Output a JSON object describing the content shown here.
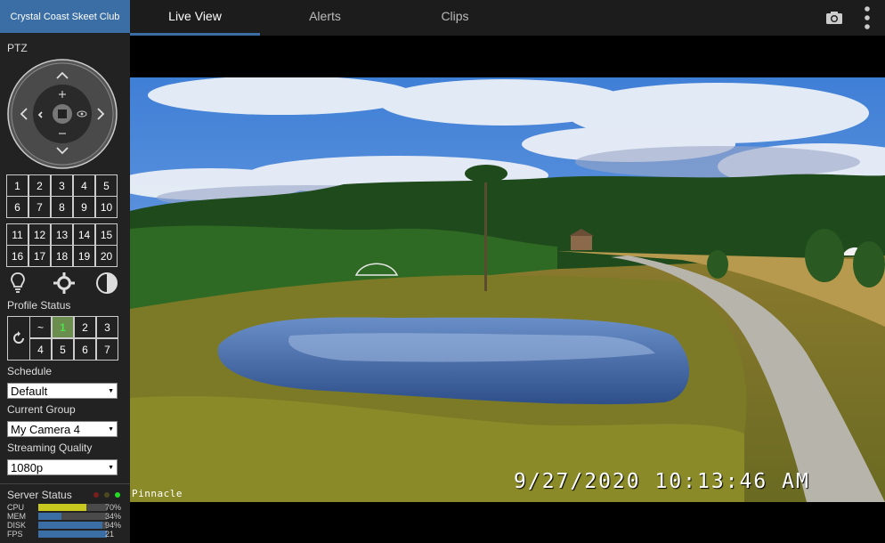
{
  "app": {
    "title": "Crystal Coast Skeet Club"
  },
  "tabs": [
    {
      "label": "Live View",
      "active": true
    },
    {
      "label": "Alerts",
      "active": false
    },
    {
      "label": "Clips",
      "active": false
    }
  ],
  "icons": {
    "snapshot": "camera-icon",
    "menu": "vertical-dots-icon"
  },
  "ptz": {
    "title": "PTZ"
  },
  "presets": {
    "group1": [
      "1",
      "2",
      "3",
      "4",
      "5",
      "6",
      "7",
      "8",
      "9",
      "10"
    ],
    "group2": [
      "11",
      "12",
      "13",
      "14",
      "15",
      "16",
      "17",
      "18",
      "19",
      "20"
    ]
  },
  "profile": {
    "title": "Profile Status",
    "cells": [
      "~",
      "1",
      "2",
      "3",
      "4",
      "5",
      "6",
      "7"
    ],
    "active": "1"
  },
  "schedule": {
    "label": "Schedule",
    "value": "Default"
  },
  "group": {
    "label": "Current Group",
    "value": "My Camera 4"
  },
  "quality": {
    "label": "Streaming Quality",
    "value": "1080p"
  },
  "server": {
    "title": "Server Status",
    "stats": [
      {
        "name": "CPU",
        "value": "70%",
        "level": 0.7,
        "color": "#c8c81e"
      },
      {
        "name": "MEM",
        "value": "34%",
        "level": 0.34,
        "color": "#3a6ea5"
      },
      {
        "name": "DISK",
        "value": "94%",
        "level": 0.94,
        "color": "#3a6ea5"
      },
      {
        "name": "FPS",
        "value": "21",
        "level": 1.0,
        "color": "#3a6ea5"
      }
    ],
    "indicator_colors": [
      "#7a1e1e",
      "#4a4a1e",
      "#22dd22"
    ]
  },
  "camera": {
    "name": "Pinnacle",
    "timestamp": "9/27/2020 10:13:46 AM"
  }
}
